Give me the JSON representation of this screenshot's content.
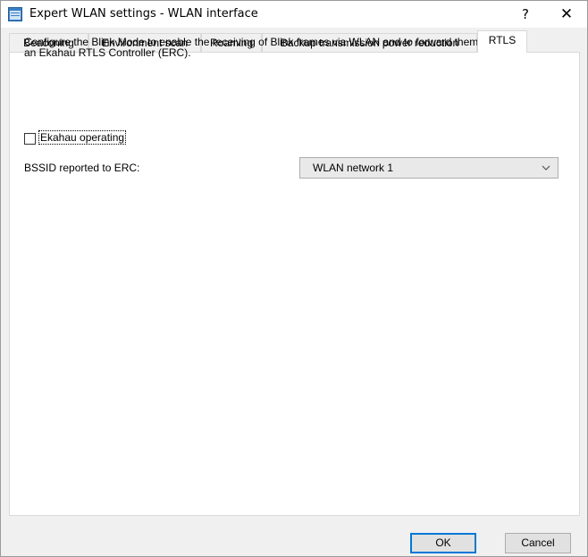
{
  "window": {
    "title": "Expert WLAN settings - WLAN interface",
    "help_label": "?",
    "close_label": "✕"
  },
  "tabs": [
    {
      "label": "Beaconing",
      "active": false
    },
    {
      "label": "Environment scan",
      "active": false
    },
    {
      "label": "Roaming",
      "active": false
    },
    {
      "label": "Backup transmission power reduction",
      "active": false
    },
    {
      "label": "RTLS",
      "active": true
    }
  ],
  "rtls": {
    "description_line1": "Configure the Blink Mode to enable the receiving of Blink frames via WLAN and to forward them to",
    "description_line2": "an Ekahau RTLS Controller (ERC).",
    "ekahau_label": "Ekahau operating",
    "ekahau_checked": false,
    "bssid_label": "BSSID reported to ERC:",
    "bssid_value": "WLAN network 1"
  },
  "buttons": {
    "ok_label": "OK",
    "cancel_label": "Cancel"
  },
  "colors": {
    "accent": "#0078d7",
    "panel": "#ffffff",
    "dialog": "#f0f0f0"
  }
}
